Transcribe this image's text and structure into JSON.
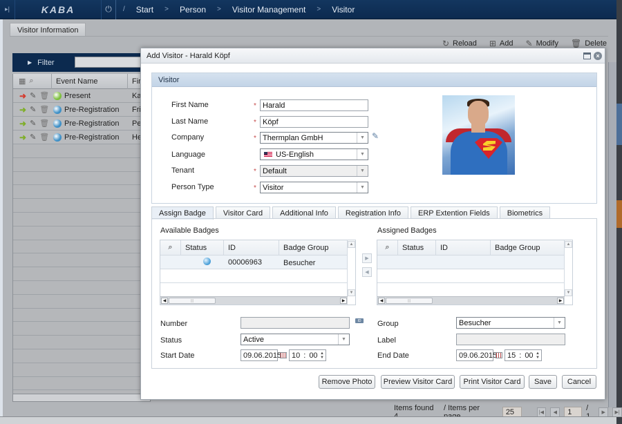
{
  "topbar": {
    "logo": "KABA",
    "breadcrumb_root": "/",
    "breadcrumbs": [
      "Start",
      "Person",
      "Visitor Management",
      "Visitor"
    ],
    "separator": ">"
  },
  "main": {
    "tab_label": "Visitor Information",
    "toolbar": {
      "reload": "Reload",
      "add": "Add",
      "modify": "Modify",
      "delete": "Delete"
    },
    "filter_label": "Filter",
    "grid": {
      "columns": [
        "Event Name",
        "Firs"
      ],
      "rows": [
        {
          "event": "Present",
          "first": "Ka",
          "status_color": "#7cbf3b",
          "action_color": "#d43c2f"
        },
        {
          "event": "Pre-Registration",
          "first": "Fri",
          "status_color": "#3d8fc6",
          "action_color": "#7fae2a"
        },
        {
          "event": "Pre-Registration",
          "first": "Pe",
          "status_color": "#3d8fc6",
          "action_color": "#7fae2a"
        },
        {
          "event": "Pre-Registration",
          "first": "He",
          "status_color": "#3d8fc6",
          "action_color": "#7fae2a"
        }
      ]
    },
    "pager": {
      "items_found": "Items found 4",
      "items_per_page_label": "/ Items per page",
      "items_per_page": "25",
      "page": "1",
      "total_pages": "/ 1"
    }
  },
  "dialog": {
    "title": "Add Visitor  -  Harald Köpf",
    "section_title": "Visitor",
    "fields": {
      "first_name": {
        "label": "First Name",
        "value": "Harald"
      },
      "last_name": {
        "label": "Last Name",
        "value": "Köpf"
      },
      "company": {
        "label": "Company",
        "value": "Thermplan GmbH"
      },
      "language": {
        "label": "Language",
        "value": "US-English"
      },
      "tenant": {
        "label": "Tenant",
        "value": "Default"
      },
      "person_type": {
        "label": "Person Type",
        "value": "Visitor"
      }
    },
    "required_mark": "*",
    "tabs": [
      "Assign Badge",
      "Visitor Card",
      "Additional Info",
      "Registration Info",
      "ERP Extention Fields",
      "Biometrics"
    ],
    "available_badges": {
      "title": "Available Badges",
      "columns": [
        "Status",
        "ID",
        "Badge Group"
      ],
      "rows": [
        {
          "id": "00006963",
          "group": "Besucher",
          "status_color": "#4a9fd8"
        }
      ]
    },
    "assigned_badges": {
      "title": "Assigned Badges",
      "columns": [
        "Status",
        "ID",
        "Badge Group"
      ],
      "rows": []
    },
    "badge_form": {
      "number_label": "Number",
      "number_value": "",
      "status_label": "Status",
      "status_value": "Active",
      "start_date_label": "Start Date",
      "start_date": "09.06.2015",
      "start_hour": "10",
      "start_min": "00",
      "group_label": "Group",
      "group_value": "Besucher",
      "label_label": "Label",
      "label_value": "",
      "end_date_label": "End Date",
      "end_date": "09.06.2015",
      "end_hour": "15",
      "end_min": "00",
      "time_sep": ":"
    },
    "buttons": {
      "remove_photo": "Remove Photo",
      "preview_card": "Preview Visitor Card",
      "print_card": "Print Visitor Card",
      "save": "Save",
      "cancel": "Cancel"
    }
  }
}
